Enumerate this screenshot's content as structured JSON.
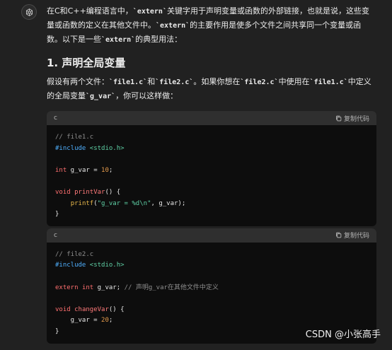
{
  "intro": {
    "t1": "在C和C++编程语言中，",
    "c1": "`extern`",
    "t2": "关键字用于声明变量或函数的外部链接，也就是说，这些变量或函数的定义在其他文件中。",
    "c2": "`extern`",
    "t3": "的主要作用是使多个文件之间共享同一个变量或函数。以下是一些",
    "c3": "`extern`",
    "t4": "的典型用法："
  },
  "section1": {
    "heading": "1. 声明全局变量",
    "t1": "假设有两个文件：",
    "c1": "`file1.c`",
    "t2": "和",
    "c2": "`file2.c`",
    "t3": "。如果你想在",
    "c3": "`file2.c`",
    "t4": "中使用在",
    "c4": "`file1.c`",
    "t5": "中定义的全局变量",
    "c5": "`g_var`",
    "t6": "，你可以这样做："
  },
  "codeblocks": [
    {
      "lang": "c",
      "copy_label": "复制代码",
      "lines": {
        "l1": "// file1.c",
        "l2a": "#include",
        "l2b": " ",
        "l2c": "<stdio.h>",
        "l3a": "int",
        "l3b": " g_var = ",
        "l3c": "10",
        "l3d": ";",
        "l4a": "void",
        "l4b": " ",
        "l4c": "printVar",
        "l4d": "() {",
        "l5a": "    ",
        "l5b": "printf",
        "l5c": "(",
        "l5d": "\"g_var = %d\\n\"",
        "l5e": ", g_var);",
        "l6": "}"
      }
    },
    {
      "lang": "c",
      "copy_label": "复制代码",
      "lines": {
        "l1": "// file2.c",
        "l2a": "#include",
        "l2b": " ",
        "l2c": "<stdio.h>",
        "l3a": "extern",
        "l3b": " ",
        "l3c": "int",
        "l3d": " g_var; ",
        "l3e": "// 声明g_var在其他文件中定义",
        "l4a": "void",
        "l4b": " ",
        "l4c": "changeVar",
        "l4d": "() {",
        "l5a": "    g_var = ",
        "l5b": "20",
        "l5c": ";",
        "l6": "}"
      }
    }
  ],
  "watermark": "CSDN @小张高手",
  "colors": {
    "background": "#212121",
    "code_bg": "#0d0d0d",
    "code_header": "#2f2f2f"
  },
  "icons": {
    "avatar": "openai-logo-icon",
    "copy": "copy-icon"
  }
}
